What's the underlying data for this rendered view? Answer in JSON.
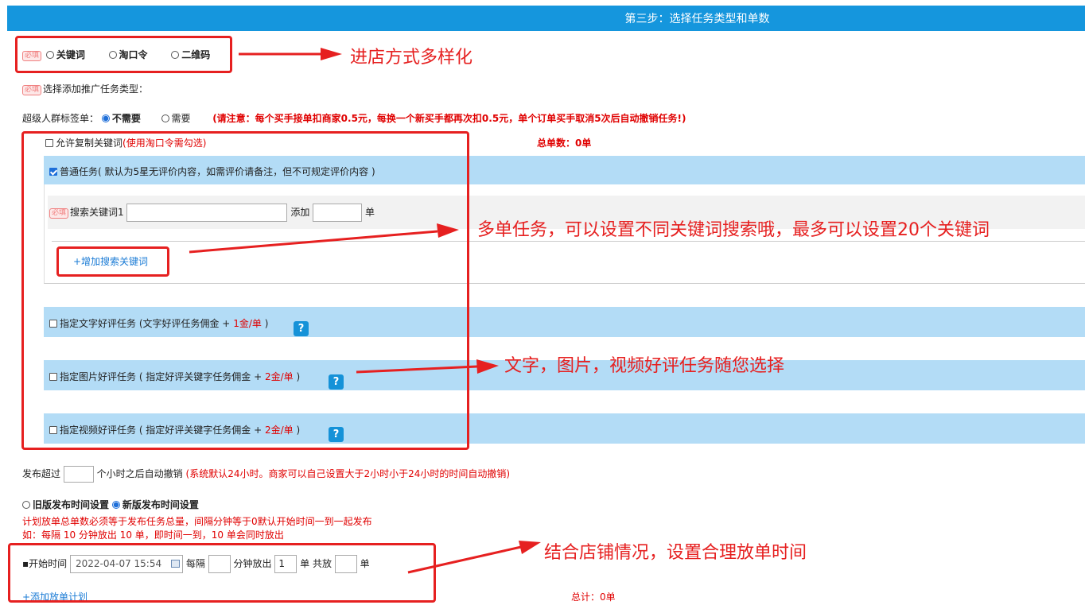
{
  "header": {
    "title": "第三步：选择任务类型和单数"
  },
  "entry_methods": {
    "badge": "必填",
    "options": [
      "关键词",
      "淘口令",
      "二维码"
    ]
  },
  "task_type": {
    "badge": "必填",
    "label": "选择添加推广任务类型："
  },
  "super_crowd": {
    "label": "超级人群标签单：",
    "opt_no": "不需要",
    "opt_yes": "需要",
    "notice": "(请注意：每个买手接单扣商家0.5元，每换一个新买手都再次扣0.5元，单个订单买手取消5次后自动撤销任务!)"
  },
  "copy_keyword": {
    "label": "允许复制关键词",
    "hint": "(使用淘口令需勾选)"
  },
  "total_orders": "总单数：0单",
  "normal_task": {
    "label": "普通任务( 默认为5星无评价内容，如需评价请备注，但不可规定评价内容 )"
  },
  "keyword_row": {
    "badge": "必填",
    "label": "搜索关键词1",
    "add_label": "添加",
    "unit": "单",
    "add_keyword_link": "+增加搜索关键词"
  },
  "review_tasks": {
    "text": {
      "label": "指定文字好评任务 (文字好评任务佣金 + ",
      "fee": "1金/单",
      "end": " )"
    },
    "image": {
      "label": "指定图片好评任务 ( 指定好评关键字任务佣金 + ",
      "fee": "2金/单",
      "end": " )"
    },
    "video": {
      "label": "指定视频好评任务 ( 指定好评关键字任务佣金 + ",
      "fee": "2金/单",
      "end": " )"
    },
    "help": "?"
  },
  "auto_cancel": {
    "prefix": "发布超过",
    "suffix": "个小时之后自动撤销",
    "hint": "(系统默认24小时。商家可以自己设置大于2小时小于24小时的时间自动撤销)"
  },
  "publish_time": {
    "old": "旧版发布时间设置",
    "new": "新版发布时间设置",
    "note1": "计划放单总单数必须等于发布任务总量，间隔分钟等于0默认开始时间一到一起发布",
    "note2": "如：每隔 10 分钟放出 10 单，即时间一到，10 单会同时放出"
  },
  "schedule": {
    "bullet": "▪",
    "start_label": "开始时间",
    "start_value": "2022-04-07 15:54",
    "every": "每隔",
    "minutes_release": "分钟放出",
    "release_count": "1",
    "orders_total": "单 共放",
    "unit": "单",
    "add_plan": "+添加放单计划",
    "total": "总计：0单"
  },
  "annotations": {
    "a1": "进店方式多样化",
    "a2": "多单任务，可以设置不同关键词搜索哦，最多可以设置20个关键词",
    "a3": "文字，图片，视频好评任务随您选择",
    "a4": "结合店铺情况，设置合理放单时间"
  },
  "colors": {
    "header": "#1596dd",
    "band": "#b3dcf6",
    "annotation": "#e62020",
    "link": "#1a7bd5"
  }
}
